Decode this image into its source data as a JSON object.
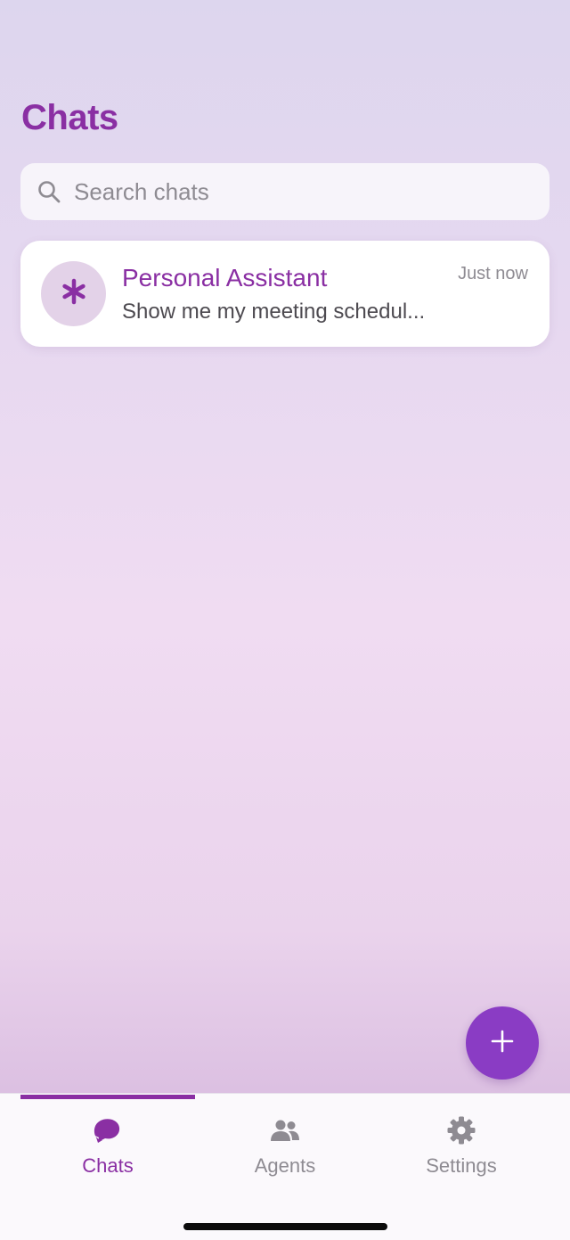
{
  "header": {
    "title": "Chats"
  },
  "search": {
    "placeholder": "Search chats"
  },
  "chats": [
    {
      "name": "Personal Assistant",
      "time": "Just now",
      "preview": "Show me my meeting schedul...",
      "avatar_icon": "asterisk-icon"
    }
  ],
  "fab": {
    "icon": "plus-icon"
  },
  "tabs": [
    {
      "label": "Chats",
      "icon": "chat-bubbles-icon",
      "active": true
    },
    {
      "label": "Agents",
      "icon": "people-icon",
      "active": false
    },
    {
      "label": "Settings",
      "icon": "gear-icon",
      "active": false
    }
  ],
  "colors": {
    "accent": "#8a2fa3",
    "fab": "#8a3cc4",
    "inactive": "#8e8b92"
  }
}
